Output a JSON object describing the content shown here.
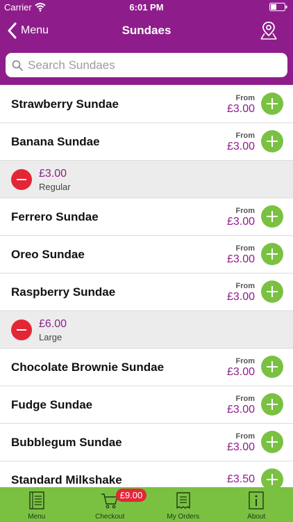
{
  "status_bar": {
    "carrier": "Carrier",
    "time": "6:01 PM"
  },
  "nav": {
    "back_label": "Menu",
    "title": "Sundaes"
  },
  "search": {
    "placeholder": "Search Sundaes"
  },
  "items": [
    {
      "name": "Strawberry Sundae",
      "from": "From",
      "price": "£3.00"
    },
    {
      "name": "Banana Sundae",
      "from": "From",
      "price": "£3.00"
    },
    {
      "option_price": "£3.00",
      "option_size": "Regular"
    },
    {
      "name": "Ferrero Sundae",
      "from": "From",
      "price": "£3.00"
    },
    {
      "name": "Oreo Sundae",
      "from": "From",
      "price": "£3.00"
    },
    {
      "name": "Raspberry Sundae",
      "from": "From",
      "price": "£3.00"
    },
    {
      "option_price": "£6.00",
      "option_size": "Large"
    },
    {
      "name": "Chocolate Brownie Sundae",
      "from": "From",
      "price": "£3.00"
    },
    {
      "name": "Fudge Sundae",
      "from": "From",
      "price": "£3.00"
    },
    {
      "name": "Bubblegum Sundae",
      "from": "From",
      "price": "£3.00"
    },
    {
      "name": "Standard Milkshake",
      "price": "£3.50"
    }
  ],
  "tabs": [
    {
      "label": "Menu",
      "icon": "menu-book-icon"
    },
    {
      "label": "Checkout",
      "icon": "cart-icon"
    },
    {
      "label": "My Orders",
      "icon": "receipt-icon"
    },
    {
      "label": "About",
      "icon": "info-icon"
    }
  ],
  "cart_badge": "£9.00",
  "colors": {
    "brand": "#8e1d8b",
    "accent": "#7ac142",
    "remove": "#e32636"
  }
}
